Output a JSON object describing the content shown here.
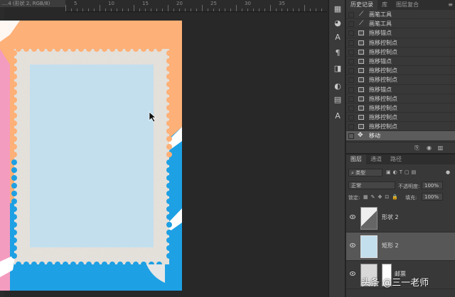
{
  "document": {
    "tab_title": "….4 (形状 2, RGB/8)",
    "ruler_numbers": [
      "5",
      "10",
      "15",
      "20",
      "25",
      "30",
      "35"
    ]
  },
  "colors": {
    "app_bg": "#282828",
    "stamp_inner": "#c3dfee",
    "orange": "#fdb077",
    "blue": "#1ea0e4",
    "pink": "#f49cbf"
  },
  "history_panel": {
    "tabs": [
      "历史记录",
      "库",
      "图层复合"
    ],
    "items": [
      {
        "label": "画笔工具",
        "icon": "brush-icon"
      },
      {
        "label": "画笔工具",
        "icon": "brush-icon"
      },
      {
        "label": "拖移锚点",
        "icon": "document-icon"
      },
      {
        "label": "拖移控制点",
        "icon": "document-icon"
      },
      {
        "label": "拖移控制点",
        "icon": "document-icon"
      },
      {
        "label": "拖移锚点",
        "icon": "document-icon"
      },
      {
        "label": "拖移控制点",
        "icon": "document-icon"
      },
      {
        "label": "拖移控制点",
        "icon": "document-icon"
      },
      {
        "label": "拖移锚点",
        "icon": "document-icon"
      },
      {
        "label": "拖移控制点",
        "icon": "document-icon"
      },
      {
        "label": "拖移控制点",
        "icon": "document-icon"
      },
      {
        "label": "拖移控制点",
        "icon": "document-icon"
      },
      {
        "label": "拖移控制点",
        "icon": "document-icon"
      },
      {
        "label": "移动",
        "icon": "move-icon"
      }
    ]
  },
  "layers_panel": {
    "tabs": [
      "图层",
      "通道",
      "路径"
    ],
    "filter_label": "类型",
    "blend_mode": "正常",
    "opacity_label": "不透明度:",
    "opacity_value": "100%",
    "lock_label": "锁定:",
    "fill_label": "填充:",
    "fill_value": "100%",
    "layers": [
      {
        "name": "形状 2",
        "selected": false
      },
      {
        "name": "矩形 2",
        "selected": true
      },
      {
        "name": "邮票",
        "selected": false
      }
    ]
  },
  "watermark": "头条 @三一老师"
}
